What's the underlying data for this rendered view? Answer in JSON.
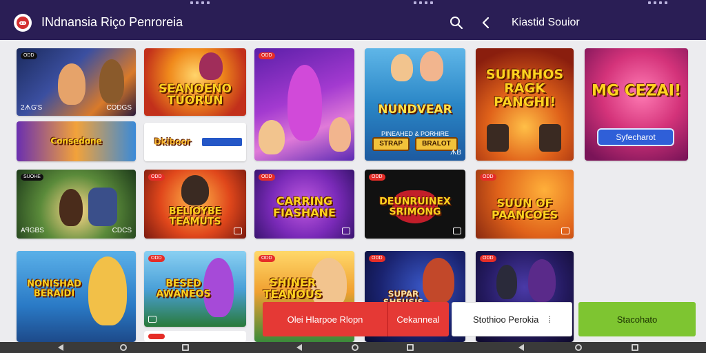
{
  "header": {
    "app_title": "INdnansia Riço Penroreia",
    "section_title": "Kiastid Souior"
  },
  "icons": {
    "logo": "game-controller-icon",
    "search": "search-icon",
    "back": "chevron-left-icon"
  },
  "cards": {
    "c1": {
      "tag": "ODD",
      "left": "2ᗑG'S",
      "right": "CODGS"
    },
    "c2": {
      "title": "SEANOENO TUORUN"
    },
    "c3": {
      "tag": "ODD"
    },
    "c4": {
      "title": "NUNDVEAR",
      "subline": "PINEAHED & PORHIRE",
      "btn1": "STRAP",
      "btn2": "BRALOT",
      "right": "ᗑB"
    },
    "c5": {
      "title": "SUIRNHOS RAGK PANGHI!"
    },
    "c6": {
      "title": "MG CEZAI!",
      "button": "Syfecharot"
    },
    "c7": {
      "title": "Consedone"
    },
    "c8": {
      "title": "Dkiboor"
    },
    "c9": {
      "tag": "SUOHE",
      "left": "AꟼGBS",
      "right": "CDCS"
    },
    "c10": {
      "tag": "ODD",
      "title": "BELIOYBE TEAMUTS"
    },
    "c11": {
      "tag": "ODD",
      "title": "CARRING FIASHANE"
    },
    "c12": {
      "tag": "ODD",
      "title": "DEUNRUINEX SRIMONG"
    },
    "c13": {
      "tag": "ODD",
      "title": "SUUN OF PAANCOES"
    },
    "c14": {
      "title": "NONISHAD BERAIDI"
    },
    "c15": {
      "tag": "ODD",
      "title": "BESED AWANEOS"
    },
    "c16": {
      "tag": "ODD",
      "title": "SHINER TEANOUS"
    },
    "c17": {
      "tag": "ODD",
      "title": "SUPAR SHEUSIS"
    },
    "c18": {
      "tag": "ODD"
    }
  },
  "actions": {
    "red_primary": "Olei Hlarpoe Rlopn",
    "red_secondary": "Cekanneal",
    "white": "Stothioo Perokia",
    "green": "Stacohato"
  },
  "colors": {
    "header_bg": "#2a1e55",
    "red": "#e53935",
    "green": "#7ec531",
    "background": "#ececef"
  }
}
